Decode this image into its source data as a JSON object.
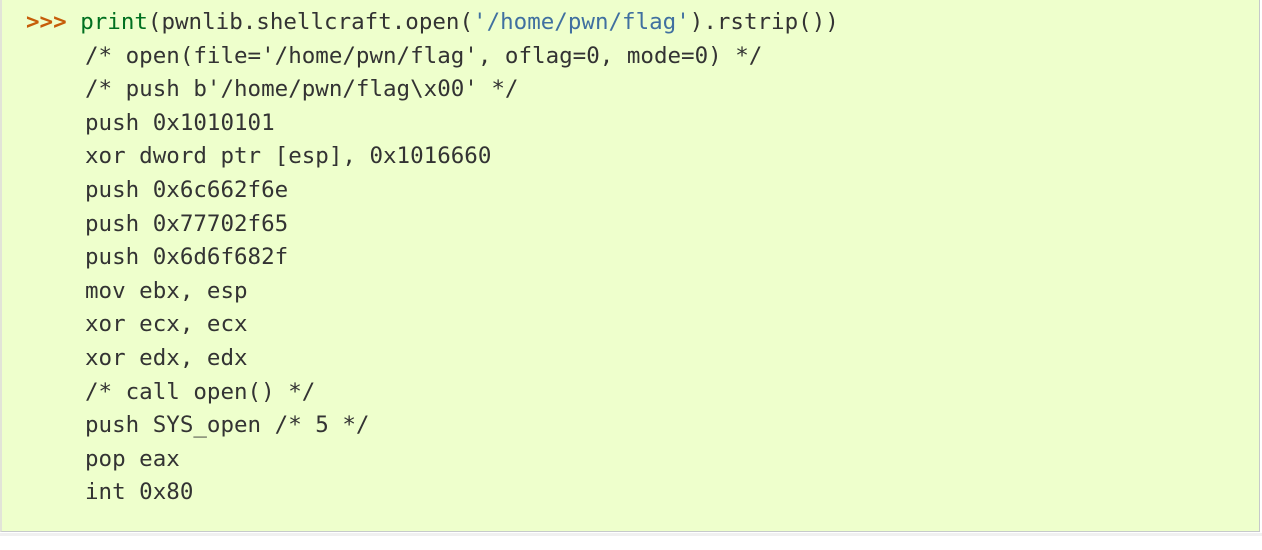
{
  "colors": {
    "background": "#eeffcc",
    "prompt": "#c65d09",
    "builtin": "#007020",
    "string": "#4070a0",
    "text": "#333333"
  },
  "input_line": {
    "prompt": ">>>",
    "separator": " ",
    "func": "print",
    "call_prefix": "(pwnlib.shellcraft.open(",
    "string_literal": "'/home/pwn/flag'",
    "call_suffix": ").rstrip())"
  },
  "output_lines": [
    "/* open(file='/home/pwn/flag', oflag=0, mode=0) */",
    "/* push b'/home/pwn/flag\\x00' */",
    "push 0x1010101",
    "xor dword ptr [esp], 0x1016660",
    "push 0x6c662f6e",
    "push 0x77702f65",
    "push 0x6d6f682f",
    "mov ebx, esp",
    "xor ecx, ecx",
    "xor edx, edx",
    "/* call open() */",
    "push SYS_open /* 5 */",
    "pop eax",
    "int 0x80"
  ]
}
